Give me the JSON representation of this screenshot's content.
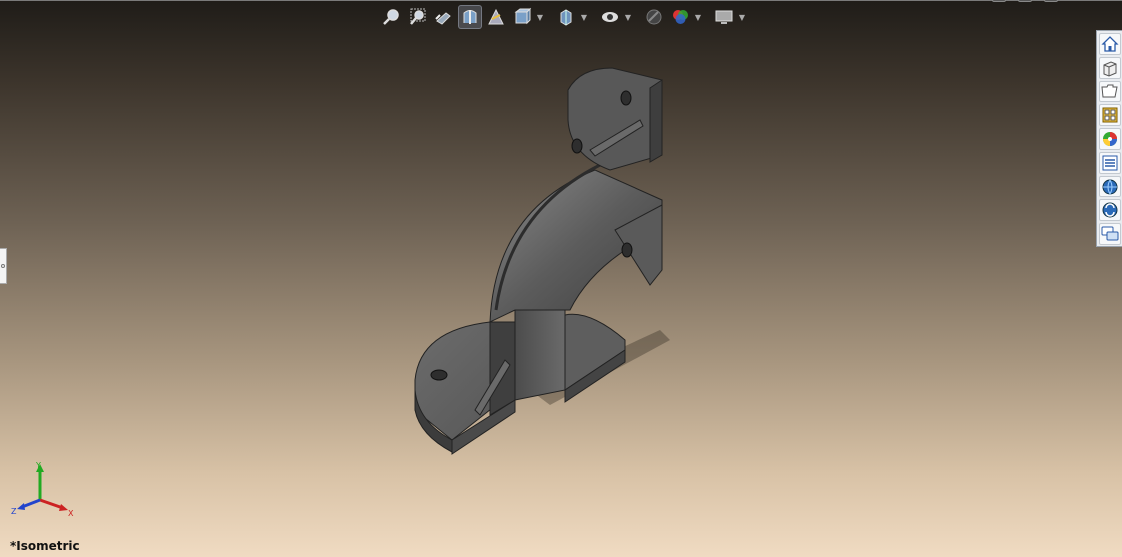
{
  "viewport": {
    "view_name": "*Isometric",
    "background": {
      "top": "#1f1c18",
      "bottom": "#f0dbc2"
    },
    "model_color": "#5a5a5a"
  },
  "hud_toolbar": {
    "items": [
      {
        "name": "zoom-to-fit-icon",
        "type": "button"
      },
      {
        "name": "zoom-to-area-icon",
        "type": "button"
      },
      {
        "name": "previous-view-icon",
        "type": "button"
      },
      {
        "name": "section-view-icon",
        "type": "button",
        "active": true
      },
      {
        "name": "dynamic-annotation-icon",
        "type": "button"
      },
      {
        "name": "view-orientation-icon",
        "type": "button",
        "dropdown": true
      },
      {
        "name": "display-style-icon",
        "type": "button",
        "dropdown": true
      },
      {
        "name": "hide-show-items-icon",
        "type": "button",
        "dropdown": true
      },
      {
        "name": "edit-appearance-icon",
        "type": "button"
      },
      {
        "name": "apply-scene-icon",
        "type": "button",
        "dropdown": true
      },
      {
        "name": "view-settings-icon",
        "type": "button",
        "dropdown": true
      }
    ]
  },
  "task_pane": {
    "tabs": [
      "solidworks-resources-icon",
      "design-library-icon",
      "file-explorer-icon",
      "view-palette-icon",
      "appearances-scenes-icon",
      "custom-properties-icon",
      "solidworks-forum-icon",
      "toolbox-icon",
      "discussion-icon"
    ]
  },
  "triad": {
    "x_label": "X",
    "y_label": "Y",
    "z_label": "Z",
    "x_color": "#cc2222",
    "y_color": "#22aa22",
    "z_color": "#2244cc"
  }
}
